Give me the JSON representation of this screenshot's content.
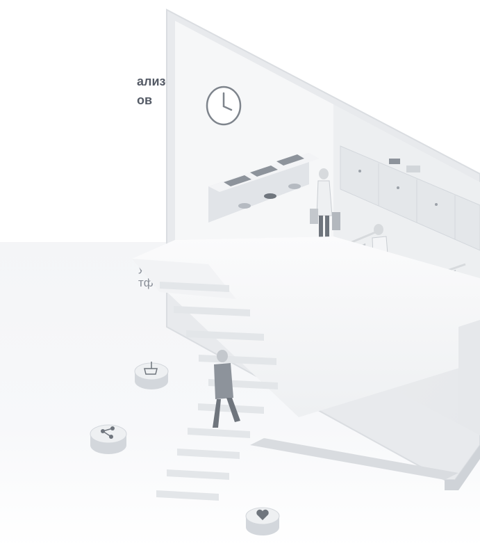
{
  "heading": {
    "line1": "ализовать",
    "line2": "ов"
  },
  "description": {
    "line1": "утером",
    "line2": "тфона"
  },
  "illustration": {
    "icons": [
      "clock-icon",
      "cart-download-icon",
      "share-icon",
      "heart-icon"
    ]
  }
}
